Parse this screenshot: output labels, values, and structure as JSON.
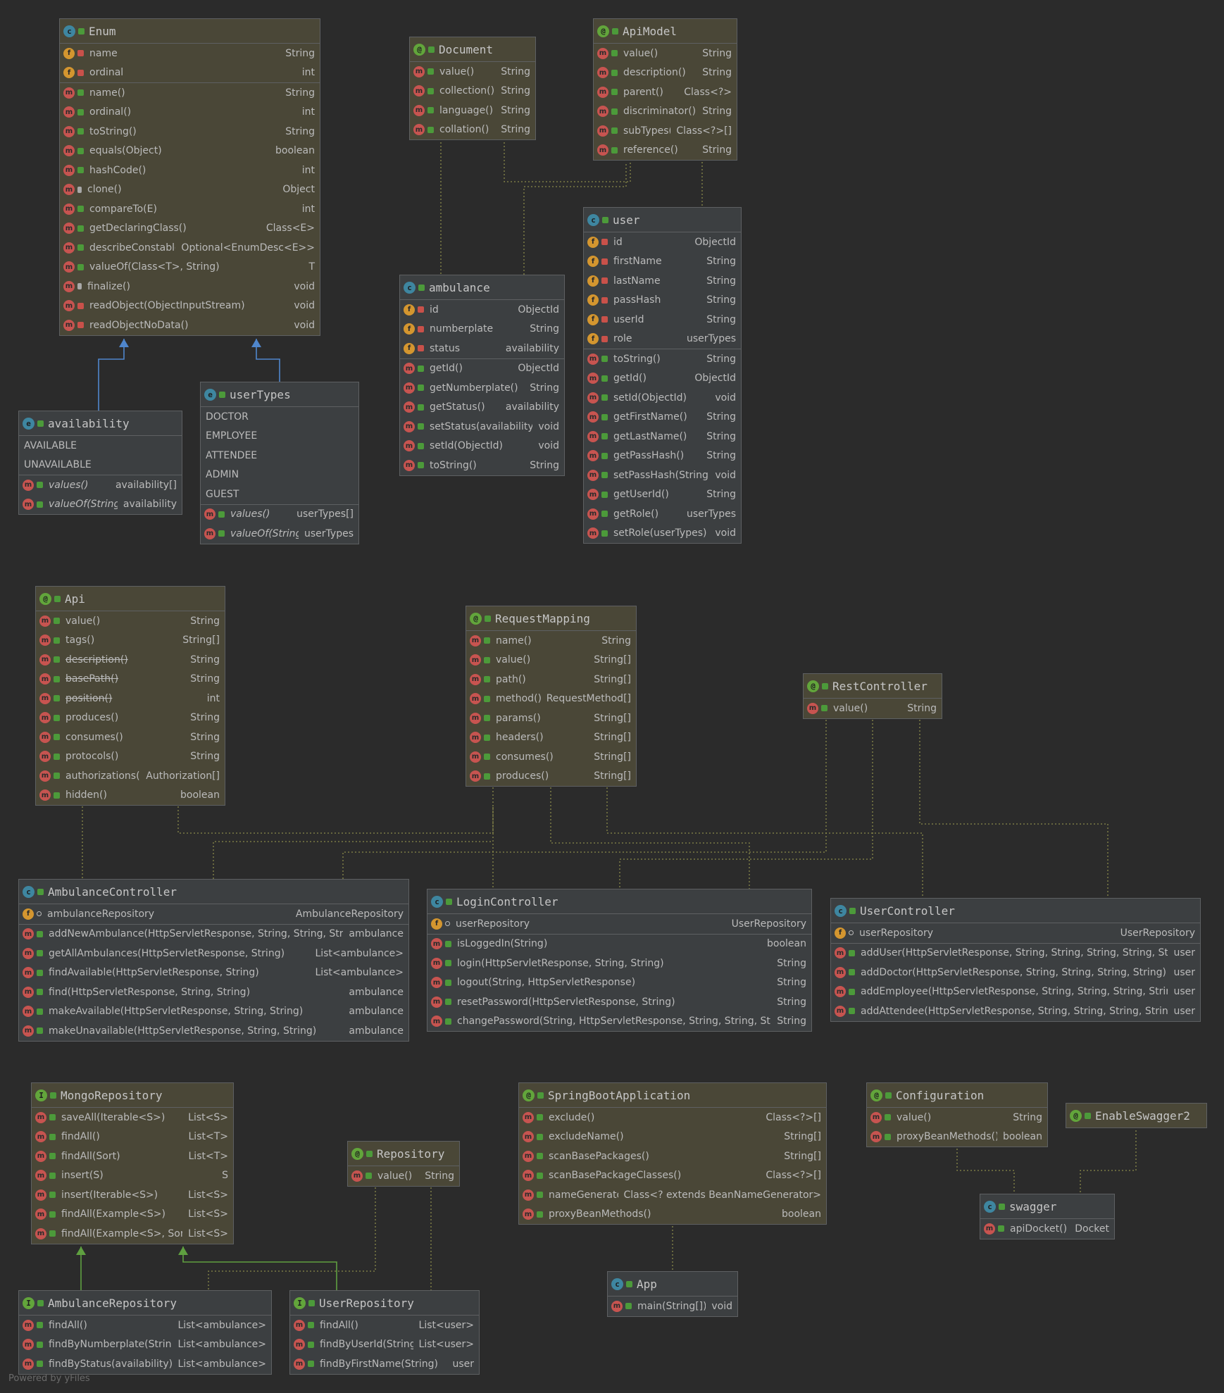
{
  "footer": "Powered by yFiles",
  "nodes": [
    {
      "id": "enum",
      "name": "Enum",
      "badge": "c",
      "tint": true,
      "sections": [
        [
          {
            "k": "f",
            "lock": "red",
            "text": "name",
            "type": "String"
          },
          {
            "k": "f",
            "lock": "red",
            "text": "ordinal",
            "type": "int"
          }
        ],
        [
          {
            "k": "m",
            "text": "name()",
            "type": "String"
          },
          {
            "k": "m",
            "text": "ordinal()",
            "type": "int"
          },
          {
            "k": "m",
            "text": "toString()",
            "type": "String"
          },
          {
            "k": "m",
            "text": "equals(Object)",
            "type": "boolean"
          },
          {
            "k": "m",
            "text": "hashCode()",
            "type": "int"
          },
          {
            "k": "m",
            "lock": "key",
            "text": "clone()",
            "type": "Object"
          },
          {
            "k": "m",
            "text": "compareTo(E)",
            "type": "int"
          },
          {
            "k": "m",
            "text": "getDeclaringClass()",
            "type": "Class<E>"
          },
          {
            "k": "m",
            "text": "describeConstable()",
            "type": "Optional<EnumDesc<E>>"
          },
          {
            "k": "m",
            "text": "valueOf(Class<T>, String)",
            "type": "T"
          },
          {
            "k": "m",
            "lock": "key",
            "text": "finalize()",
            "type": "void"
          },
          {
            "k": "m",
            "lock": "red",
            "text": "readObject(ObjectInputStream)",
            "type": "void"
          },
          {
            "k": "m",
            "lock": "red",
            "text": "readObjectNoData()",
            "type": "void"
          }
        ]
      ]
    },
    {
      "id": "document",
      "name": "Document",
      "badge": "a",
      "tint": true,
      "sections": [
        [
          {
            "k": "m",
            "text": "value()",
            "type": "String"
          },
          {
            "k": "m",
            "text": "collection()",
            "type": "String"
          },
          {
            "k": "m",
            "text": "language()",
            "type": "String"
          },
          {
            "k": "m",
            "text": "collation()",
            "type": "String"
          }
        ]
      ]
    },
    {
      "id": "apimodel",
      "name": "ApiModel",
      "badge": "a",
      "tint": true,
      "sections": [
        [
          {
            "k": "m",
            "text": "value()",
            "type": "String"
          },
          {
            "k": "m",
            "text": "description()",
            "type": "String"
          },
          {
            "k": "m",
            "text": "parent()",
            "type": "Class<?>"
          },
          {
            "k": "m",
            "text": "discriminator()",
            "type": "String"
          },
          {
            "k": "m",
            "text": "subTypes()",
            "type": "Class<?>[]"
          },
          {
            "k": "m",
            "text": "reference()",
            "type": "String"
          }
        ]
      ]
    },
    {
      "id": "user",
      "name": "user",
      "badge": "c",
      "tint": false,
      "sections": [
        [
          {
            "k": "f",
            "lock": "red",
            "text": "id",
            "type": "ObjectId"
          },
          {
            "k": "f",
            "lock": "red",
            "text": "firstName",
            "type": "String"
          },
          {
            "k": "f",
            "lock": "red",
            "text": "lastName",
            "type": "String"
          },
          {
            "k": "f",
            "lock": "red",
            "text": "passHash",
            "type": "String"
          },
          {
            "k": "f",
            "lock": "red",
            "text": "userId",
            "type": "String"
          },
          {
            "k": "f",
            "lock": "red",
            "text": "role",
            "type": "userTypes"
          }
        ],
        [
          {
            "k": "m",
            "text": "toString()",
            "type": "String"
          },
          {
            "k": "m",
            "text": "getId()",
            "type": "ObjectId"
          },
          {
            "k": "m",
            "text": "setId(ObjectId)",
            "type": "void"
          },
          {
            "k": "m",
            "text": "getFirstName()",
            "type": "String"
          },
          {
            "k": "m",
            "text": "getLastName()",
            "type": "String"
          },
          {
            "k": "m",
            "text": "getPassHash()",
            "type": "String"
          },
          {
            "k": "m",
            "text": "setPassHash(String)",
            "type": "void"
          },
          {
            "k": "m",
            "text": "getUserId()",
            "type": "String"
          },
          {
            "k": "m",
            "text": "getRole()",
            "type": "userTypes"
          },
          {
            "k": "m",
            "text": "setRole(userTypes)",
            "type": "void"
          }
        ]
      ]
    },
    {
      "id": "ambulance",
      "name": "ambulance",
      "badge": "c",
      "tint": false,
      "sections": [
        [
          {
            "k": "f",
            "lock": "red",
            "text": "id",
            "type": "ObjectId"
          },
          {
            "k": "f",
            "lock": "red",
            "text": "numberplate",
            "type": "String"
          },
          {
            "k": "f",
            "lock": "red",
            "text": "status",
            "type": "availability"
          }
        ],
        [
          {
            "k": "m",
            "text": "getId()",
            "type": "ObjectId"
          },
          {
            "k": "m",
            "text": "getNumberplate()",
            "type": "String"
          },
          {
            "k": "m",
            "text": "getStatus()",
            "type": "availability"
          },
          {
            "k": "m",
            "text": "setStatus(availability)",
            "type": "void"
          },
          {
            "k": "m",
            "text": "setId(ObjectId)",
            "type": "void"
          },
          {
            "k": "m",
            "text": "toString()",
            "type": "String"
          }
        ]
      ]
    },
    {
      "id": "availability",
      "name": "availability",
      "badge": "e",
      "tint": false,
      "sections": [
        [
          {
            "k": "p",
            "text": "AVAILABLE"
          },
          {
            "k": "p",
            "text": "UNAVAILABLE"
          }
        ],
        [
          {
            "k": "m",
            "ital": true,
            "text": "values()",
            "type": "availability[]"
          },
          {
            "k": "m",
            "ital": true,
            "text": "valueOf(String)",
            "type": "availability"
          }
        ]
      ]
    },
    {
      "id": "usertypes",
      "name": "userTypes",
      "badge": "e",
      "tint": false,
      "sections": [
        [
          {
            "k": "p",
            "text": "DOCTOR"
          },
          {
            "k": "p",
            "text": "EMPLOYEE"
          },
          {
            "k": "p",
            "text": "ATTENDEE"
          },
          {
            "k": "p",
            "text": "ADMIN"
          },
          {
            "k": "p",
            "text": "GUEST"
          }
        ],
        [
          {
            "k": "m",
            "ital": true,
            "text": "values()",
            "type": "userTypes[]"
          },
          {
            "k": "m",
            "ital": true,
            "text": "valueOf(String)",
            "type": "userTypes"
          }
        ]
      ]
    },
    {
      "id": "api",
      "name": "Api",
      "badge": "a",
      "tint": true,
      "sections": [
        [
          {
            "k": "m",
            "text": "value()",
            "type": "String"
          },
          {
            "k": "m",
            "text": "tags()",
            "type": "String[]"
          },
          {
            "k": "m",
            "strike": true,
            "text": "description()",
            "type": "String"
          },
          {
            "k": "m",
            "strike": true,
            "text": "basePath()",
            "type": "String"
          },
          {
            "k": "m",
            "strike": true,
            "text": "position()",
            "type": "int"
          },
          {
            "k": "m",
            "text": "produces()",
            "type": "String"
          },
          {
            "k": "m",
            "text": "consumes()",
            "type": "String"
          },
          {
            "k": "m",
            "text": "protocols()",
            "type": "String"
          },
          {
            "k": "m",
            "text": "authorizations()",
            "type": "Authorization[]"
          },
          {
            "k": "m",
            "text": "hidden()",
            "type": "boolean"
          }
        ]
      ]
    },
    {
      "id": "requestmapping",
      "name": "RequestMapping",
      "badge": "a",
      "tint": true,
      "sections": [
        [
          {
            "k": "m",
            "text": "name()",
            "type": "String"
          },
          {
            "k": "m",
            "text": "value()",
            "type": "String[]"
          },
          {
            "k": "m",
            "text": "path()",
            "type": "String[]"
          },
          {
            "k": "m",
            "text": "method()",
            "type": "RequestMethod[]"
          },
          {
            "k": "m",
            "text": "params()",
            "type": "String[]"
          },
          {
            "k": "m",
            "text": "headers()",
            "type": "String[]"
          },
          {
            "k": "m",
            "text": "consumes()",
            "type": "String[]"
          },
          {
            "k": "m",
            "text": "produces()",
            "type": "String[]"
          }
        ]
      ]
    },
    {
      "id": "restcontroller",
      "name": "RestController",
      "badge": "a",
      "tint": true,
      "sections": [
        [
          {
            "k": "m",
            "text": "value()",
            "type": "String"
          }
        ]
      ]
    },
    {
      "id": "ambulancecontroller",
      "name": "AmbulanceController",
      "badge": "c",
      "tint": false,
      "sections": [
        [
          {
            "k": "f",
            "lock": "pkg",
            "text": "ambulanceRepository",
            "type": "AmbulanceRepository"
          }
        ],
        [
          {
            "k": "m",
            "text": "addNewAmbulance(HttpServletResponse, String, String, String)",
            "type": "ambulance"
          },
          {
            "k": "m",
            "text": "getAllAmbulances(HttpServletResponse, String)",
            "type": "List<ambulance>"
          },
          {
            "k": "m",
            "text": "findAvailable(HttpServletResponse, String)",
            "type": "List<ambulance>"
          },
          {
            "k": "m",
            "text": "find(HttpServletResponse, String, String)",
            "type": "ambulance"
          },
          {
            "k": "m",
            "text": "makeAvailable(HttpServletResponse, String, String)",
            "type": "ambulance"
          },
          {
            "k": "m",
            "text": "makeUnavailable(HttpServletResponse, String, String)",
            "type": "ambulance"
          }
        ]
      ]
    },
    {
      "id": "logincontroller",
      "name": "LoginController",
      "badge": "c",
      "tint": false,
      "sections": [
        [
          {
            "k": "f",
            "lock": "pkg",
            "text": "userRepository",
            "type": "UserRepository"
          }
        ],
        [
          {
            "k": "m",
            "text": "isLoggedIn(String)",
            "type": "boolean"
          },
          {
            "k": "m",
            "text": "login(HttpServletResponse, String, String)",
            "type": "String"
          },
          {
            "k": "m",
            "text": "logout(String, HttpServletResponse)",
            "type": "String"
          },
          {
            "k": "m",
            "text": "resetPassword(HttpServletResponse, String)",
            "type": "String"
          },
          {
            "k": "m",
            "text": "changePassword(String, HttpServletResponse, String, String, String)",
            "type": "String"
          }
        ]
      ]
    },
    {
      "id": "usercontroller",
      "name": "UserController",
      "badge": "c",
      "tint": false,
      "sections": [
        [
          {
            "k": "f",
            "lock": "pkg",
            "text": "userRepository",
            "type": "UserRepository"
          }
        ],
        [
          {
            "k": "m",
            "text": "addUser(HttpServletResponse, String, String, String, String, String)",
            "type": "user"
          },
          {
            "k": "m",
            "text": "addDoctor(HttpServletResponse, String, String, String, String)",
            "type": "user"
          },
          {
            "k": "m",
            "text": "addEmployee(HttpServletResponse, String, String, String, String)",
            "type": "user"
          },
          {
            "k": "m",
            "text": "addAttendee(HttpServletResponse, String, String, String, String)",
            "type": "user"
          }
        ]
      ]
    },
    {
      "id": "mongorepository",
      "name": "MongoRepository",
      "badge": "i",
      "tint": true,
      "sections": [
        [
          {
            "k": "m",
            "text": "saveAll(Iterable<S>)",
            "type": "List<S>"
          },
          {
            "k": "m",
            "text": "findAll()",
            "type": "List<T>"
          },
          {
            "k": "m",
            "text": "findAll(Sort)",
            "type": "List<T>"
          },
          {
            "k": "m",
            "text": "insert(S)",
            "type": "S"
          },
          {
            "k": "m",
            "text": "insert(Iterable<S>)",
            "type": "List<S>"
          },
          {
            "k": "m",
            "text": "findAll(Example<S>)",
            "type": "List<S>"
          },
          {
            "k": "m",
            "text": "findAll(Example<S>, Sort)",
            "type": "List<S>"
          }
        ]
      ]
    },
    {
      "id": "repository",
      "name": "Repository",
      "badge": "a",
      "tint": true,
      "sections": [
        [
          {
            "k": "m",
            "text": "value()",
            "type": "String"
          }
        ]
      ]
    },
    {
      "id": "springbootapplication",
      "name": "SpringBootApplication",
      "badge": "a",
      "tint": true,
      "sections": [
        [
          {
            "k": "m",
            "text": "exclude()",
            "type": "Class<?>[]"
          },
          {
            "k": "m",
            "text": "excludeName()",
            "type": "String[]"
          },
          {
            "k": "m",
            "text": "scanBasePackages()",
            "type": "String[]"
          },
          {
            "k": "m",
            "text": "scanBasePackageClasses()",
            "type": "Class<?>[]"
          },
          {
            "k": "m",
            "text": "nameGenerator()",
            "type": "Class<? extends BeanNameGenerator>"
          },
          {
            "k": "m",
            "text": "proxyBeanMethods()",
            "type": "boolean"
          }
        ]
      ]
    },
    {
      "id": "configuration",
      "name": "Configuration",
      "badge": "a",
      "tint": true,
      "sections": [
        [
          {
            "k": "m",
            "text": "value()",
            "type": "String"
          },
          {
            "k": "m",
            "text": "proxyBeanMethods()",
            "type": "boolean"
          }
        ]
      ]
    },
    {
      "id": "enableswagger2",
      "name": "EnableSwagger2",
      "badge": "a",
      "tint": true,
      "sections": []
    },
    {
      "id": "swagger",
      "name": "swagger",
      "badge": "c",
      "tint": false,
      "sections": [
        [
          {
            "k": "m",
            "text": "apiDocket()",
            "type": "Docket"
          }
        ]
      ]
    },
    {
      "id": "app",
      "name": "App",
      "badge": "c",
      "tint": false,
      "sections": [
        [
          {
            "k": "m",
            "text": "main(String[])",
            "type": "void"
          }
        ]
      ]
    },
    {
      "id": "ambulancerepository",
      "name": "AmbulanceRepository",
      "badge": "i",
      "tint": false,
      "sections": [
        [
          {
            "k": "m",
            "text": "findAll()",
            "type": "List<ambulance>"
          },
          {
            "k": "m",
            "text": "findByNumberplate(String)",
            "type": "List<ambulance>"
          },
          {
            "k": "m",
            "text": "findByStatus(availability)",
            "type": "List<ambulance>"
          }
        ]
      ]
    },
    {
      "id": "userrepository",
      "name": "UserRepository",
      "badge": "i",
      "tint": false,
      "sections": [
        [
          {
            "k": "m",
            "text": "findAll()",
            "type": "List<user>"
          },
          {
            "k": "m",
            "text": "findByUserId(String)",
            "type": "List<user>"
          },
          {
            "k": "m",
            "text": "findByFirstName(String)",
            "type": "user"
          }
        ]
      ]
    }
  ]
}
